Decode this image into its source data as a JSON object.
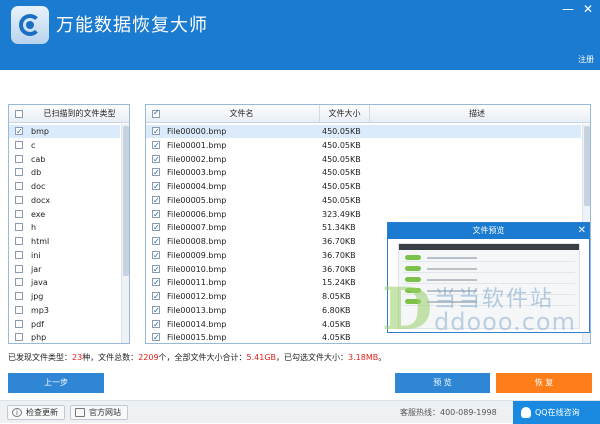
{
  "app": {
    "title": "万能数据恢复大师",
    "register": "注册"
  },
  "left_panel": {
    "header": "已扫描到的文件类型",
    "types": [
      {
        "name": "bmp",
        "checked": true
      },
      {
        "name": "c",
        "checked": false
      },
      {
        "name": "cab",
        "checked": false
      },
      {
        "name": "db",
        "checked": false
      },
      {
        "name": "doc",
        "checked": false
      },
      {
        "name": "docx",
        "checked": false
      },
      {
        "name": "exe",
        "checked": false
      },
      {
        "name": "h",
        "checked": false
      },
      {
        "name": "html",
        "checked": false
      },
      {
        "name": "ini",
        "checked": false
      },
      {
        "name": "jar",
        "checked": false
      },
      {
        "name": "java",
        "checked": false
      },
      {
        "name": "jpg",
        "checked": false
      },
      {
        "name": "mp3",
        "checked": false
      },
      {
        "name": "pdf",
        "checked": false
      },
      {
        "name": "php",
        "checked": false
      }
    ]
  },
  "file_table": {
    "columns": {
      "name": "文件名",
      "size": "文件大小",
      "desc": "描述"
    },
    "rows": [
      {
        "name": "File00000.bmp",
        "size": "450.05KB"
      },
      {
        "name": "File00001.bmp",
        "size": "450.05KB"
      },
      {
        "name": "File00002.bmp",
        "size": "450.05KB"
      },
      {
        "name": "File00003.bmp",
        "size": "450.05KB"
      },
      {
        "name": "File00004.bmp",
        "size": "450.05KB"
      },
      {
        "name": "File00005.bmp",
        "size": "450.05KB"
      },
      {
        "name": "File00006.bmp",
        "size": "323.49KB"
      },
      {
        "name": "File00007.bmp",
        "size": "51.34KB"
      },
      {
        "name": "File00008.bmp",
        "size": "36.70KB"
      },
      {
        "name": "File00009.bmp",
        "size": "36.70KB"
      },
      {
        "name": "File00010.bmp",
        "size": "36.70KB"
      },
      {
        "name": "File00011.bmp",
        "size": "15.24KB"
      },
      {
        "name": "File00012.bmp",
        "size": "8.05KB"
      },
      {
        "name": "File00013.bmp",
        "size": "6.80KB"
      },
      {
        "name": "File00014.bmp",
        "size": "4.05KB"
      },
      {
        "name": "File00015.bmp",
        "size": "4.05KB"
      }
    ]
  },
  "preview": {
    "title": "文件预览"
  },
  "watermark": {
    "cn": "当当软件站",
    "en": "ddooo.com"
  },
  "status": {
    "p1": "已发现文件类型：",
    "types": "23",
    "p2": "种，文件总数：",
    "files": "2209",
    "p3": "个，全部文件大小合计：",
    "total": "5.41GB",
    "p4": "，已勾选文件大小：",
    "selected": "3.18MB",
    "p5": "。"
  },
  "buttons": {
    "prev": "上一步",
    "preview": "预 览",
    "recover": "恢 复"
  },
  "footer": {
    "check_update": "检查更新",
    "website": "官方网站",
    "hotline": "客服热线：400-089-1998",
    "qq": "QQ在线咨询"
  },
  "colors": {
    "brand": "#1a7bd0",
    "accent": "#ff7e1a",
    "highlight": "#e0201c"
  }
}
